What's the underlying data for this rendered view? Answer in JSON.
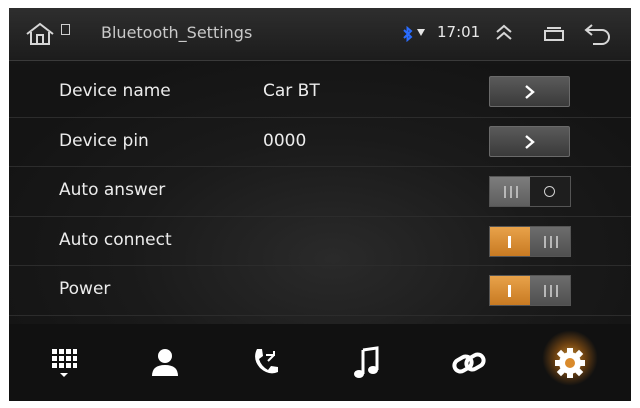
{
  "statusbar": {
    "title": "Bluetooth_Settings",
    "time": "17:01",
    "icons": [
      "home-icon",
      "sim-icon",
      "bluetooth-icon",
      "wifi-icon",
      "chevron-up-icon",
      "recent-apps-icon",
      "back-icon"
    ]
  },
  "settings": {
    "device_name": {
      "label": "Device name",
      "value": "Car BT"
    },
    "device_pin": {
      "label": "Device pin",
      "value": "0000"
    },
    "auto_answer": {
      "label": "Auto answer",
      "state": "off"
    },
    "auto_connect": {
      "label": "Auto connect",
      "state": "on"
    },
    "power": {
      "label": "Power",
      "state": "on"
    }
  },
  "bottom_nav": {
    "items": [
      "dialpad-icon",
      "contacts-icon",
      "call-log-icon",
      "music-icon",
      "link-icon",
      "settings-icon"
    ],
    "active": "settings-icon"
  },
  "colors": {
    "accent": "#e8a24a",
    "background": "#151515",
    "text": "#ececec"
  }
}
